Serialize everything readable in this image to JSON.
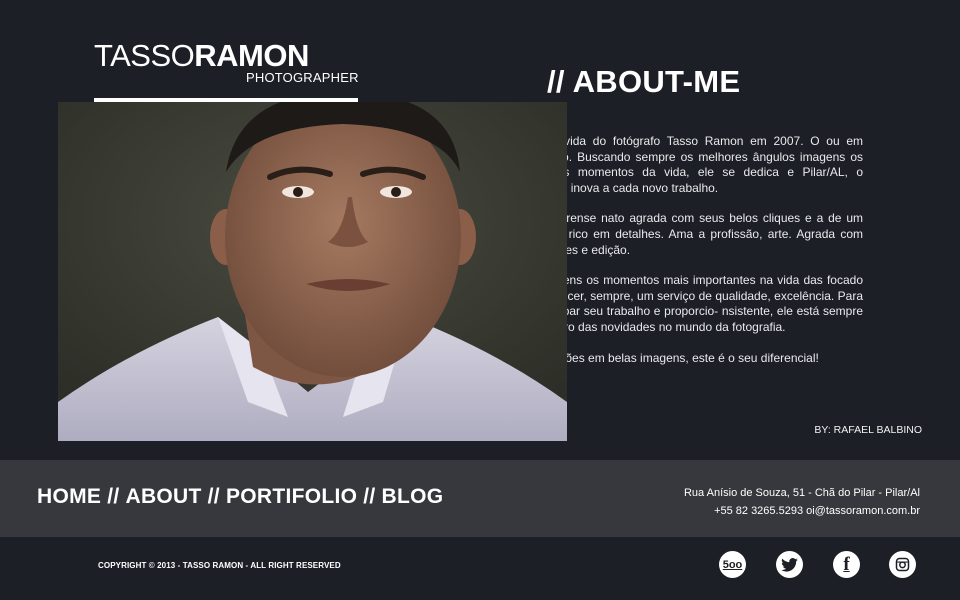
{
  "brand": {
    "first": "TASSO",
    "last": "RAMON",
    "tagline": "PHOTOGRAPHER"
  },
  "about": {
    "heading": "// ABOUT-ME",
    "paragraphs": [
      "rou na vida do fotógrafo Tasso Ramon em 2007. O ou em profissão. Buscando sempre os melhores ângulos imagens os melhores momentos da vida, ele se dedica e Pilar/AL, o fotógrafo inova a cada novo trabalho.",
      "este pilarense nato agrada com seus belos cliques e a de um trabalho rico em detalhes. Ama a profissão, arte. Agrada com suas cores e edição.",
      "as imagens os momentos mais importantes na vida das focado em oferecer, sempre, um serviço de qualidade, excelência. Para aperfeiçoar seu trabalho e proporcio- nsistente, ele está sempre por dentro das novidades no mundo da fotografia.",
      "as emoções em belas imagens, este é o seu diferencial!"
    ],
    "byline": "BY: RAFAEL BALBINO"
  },
  "nav": {
    "home": "HOME",
    "about": "ABOUT",
    "portfolio": "PORTIFOLIO",
    "blog": "BLOG",
    "separator": "//"
  },
  "contact": {
    "address": "Rua Anísio de Souza, 51 - Chã do Pilar - Pilar/Al",
    "phone_email": "+55 82 3265.5293 oi@tassoramon.com.br"
  },
  "footer": {
    "copyright": "COPYRIGHT © 2013 - TASSO RAMON - ALL RIGHT RESERVED"
  },
  "social": {
    "five_hundred_px": "5oo",
    "facebook": "f"
  },
  "colors": {
    "background": "#1c1f26",
    "band": "#36383d",
    "text": "#ffffff"
  }
}
